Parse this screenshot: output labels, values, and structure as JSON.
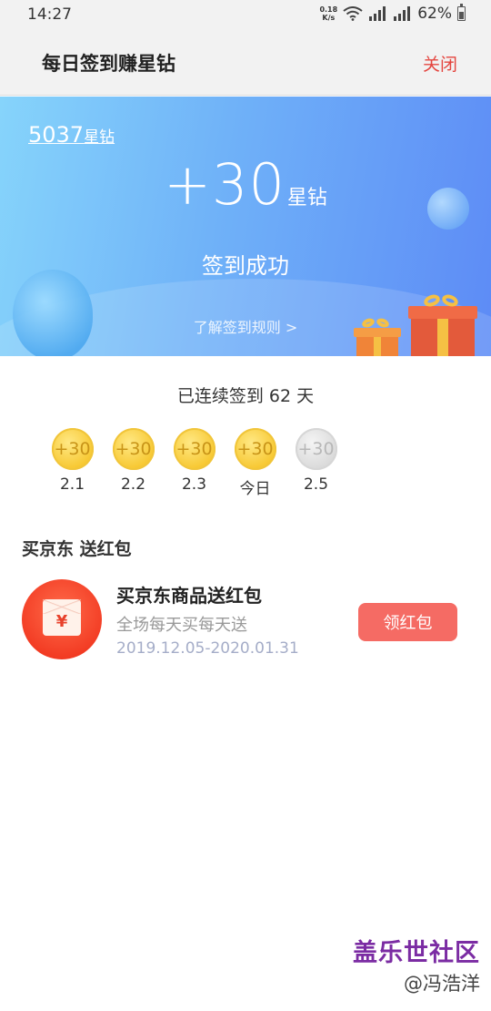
{
  "status_bar": {
    "time": "14:27",
    "net_speed_value": "0.18",
    "net_speed_unit": "K/s",
    "battery": "62%"
  },
  "header": {
    "title": "每日签到赚星钻",
    "close_label": "关闭"
  },
  "banner": {
    "balance_value": "5037",
    "balance_unit": "星钻",
    "gain_value": "+30",
    "gain_unit": "星钻",
    "status": "签到成功",
    "rules_link": "了解签到规则 >"
  },
  "streak": {
    "text": "已连续签到 62 天",
    "days": [
      {
        "coin": "+30",
        "label": "2.1",
        "state": "done"
      },
      {
        "coin": "+30",
        "label": "2.2",
        "state": "done"
      },
      {
        "coin": "+30",
        "label": "2.3",
        "state": "done"
      },
      {
        "coin": "+30",
        "label": "今日",
        "state": "done"
      },
      {
        "coin": "+30",
        "label": "2.5",
        "state": "future"
      }
    ]
  },
  "promo_section": {
    "title": "买京东 送红包",
    "item": {
      "icon_symbol": "¥",
      "title": "买京东商品送红包",
      "subtitle": "全场每天买每天送",
      "date_range": "2019.12.05-2020.01.31",
      "button_label": "领红包"
    }
  },
  "watermark": {
    "site": "盖乐世社区",
    "author": "@冯浩洋"
  },
  "colors": {
    "accent_red": "#e4453f",
    "button_red": "#f56b64",
    "coin_gold": "#f7c832",
    "watermark_purple": "#7b2ca3"
  }
}
